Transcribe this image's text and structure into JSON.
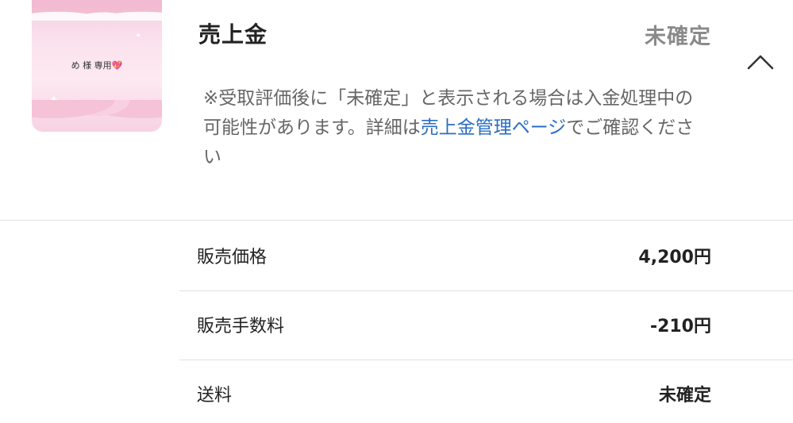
{
  "item": {
    "thumbnail_text": "め 様 専用",
    "thumbnail_heart": "💖"
  },
  "header": {
    "title": "売上金",
    "status": "未確定",
    "collapse_icon": "chevron-up-icon"
  },
  "notice": {
    "text_before": "※受取評価後に「未確定」と表示される場合は入金処理中の可能性があります。詳細は",
    "link_text": "売上金管理ページ",
    "text_after": "でご確認ください"
  },
  "breakdown": [
    {
      "label": "販売価格",
      "value": "4,200円"
    },
    {
      "label": "販売手数料",
      "value": "-210円"
    },
    {
      "label": "送料",
      "value": "未確定"
    }
  ],
  "colors": {
    "link": "#2a6dc3",
    "muted": "#8a8a8a",
    "text": "#222222"
  }
}
